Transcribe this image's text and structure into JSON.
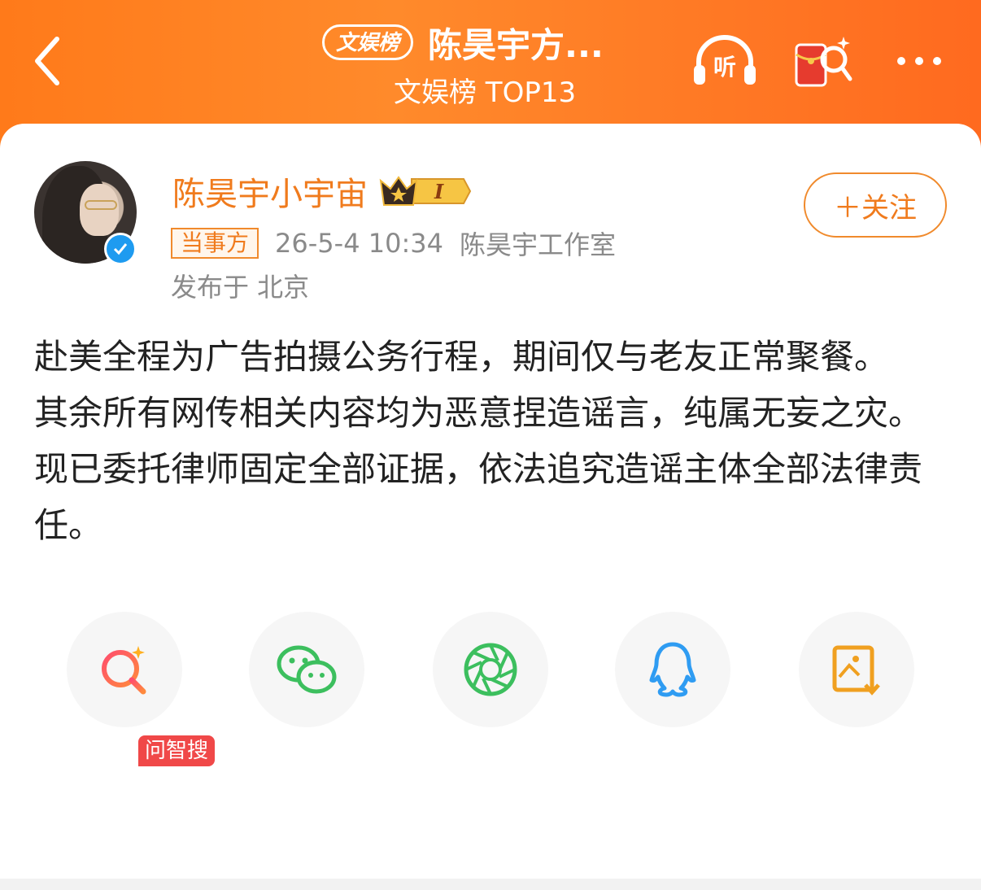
{
  "header": {
    "badge": "文娱榜",
    "title": "陈昊宇方...",
    "subtitle": "文娱榜 TOP13",
    "listen_label": "听",
    "icons": [
      "back-arrow-icon",
      "listen-icon",
      "red-packet-search-icon",
      "more-icon"
    ],
    "bg_color": "#ff7a1a"
  },
  "post": {
    "username": "陈昊宇小宇宙",
    "member_level": "I",
    "party_tag": "当事方",
    "timestamp": "26-5-4 10:34",
    "source": "陈昊宇工作室",
    "location": "发布于 北京",
    "follow_label": "＋关注",
    "paragraphs": [
      "赴美全程为广告拍摄公务行程，期间仅与老友正常聚餐。",
      "其余所有网传相关内容均为恶意捏造谣言，纯属无妄之灾。",
      "现已委托律师固定全部证据，依法追究造谣主体全部法律责任。"
    ],
    "accent_color": "#f07b1d"
  },
  "share": {
    "ai_search_tag": "问智搜",
    "buttons": [
      "ai-search-icon",
      "wechat-icon",
      "moments-icon",
      "qq-icon",
      "save-image-icon"
    ]
  }
}
